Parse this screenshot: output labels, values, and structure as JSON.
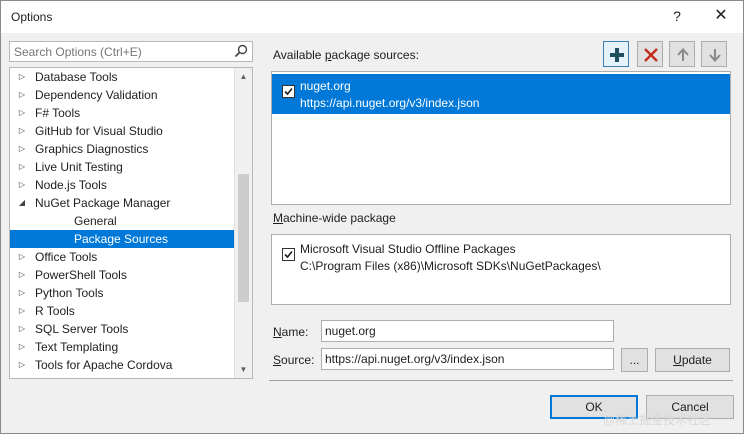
{
  "window": {
    "title": "Options",
    "help_glyph": "?",
    "close_glyph": "✕"
  },
  "search": {
    "placeholder": "Search Options (Ctrl+E)"
  },
  "tree": {
    "items": [
      {
        "label": "Database Tools",
        "level": 0,
        "expander": "▷"
      },
      {
        "label": "Dependency Validation",
        "level": 0,
        "expander": "▷"
      },
      {
        "label": "F# Tools",
        "level": 0,
        "expander": "▷"
      },
      {
        "label": "GitHub for Visual Studio",
        "level": 0,
        "expander": "▷"
      },
      {
        "label": "Graphics Diagnostics",
        "level": 0,
        "expander": "▷"
      },
      {
        "label": "Live Unit Testing",
        "level": 0,
        "expander": "▷"
      },
      {
        "label": "Node.js Tools",
        "level": 0,
        "expander": "▷"
      },
      {
        "label": "NuGet Package Manager",
        "level": 0,
        "expander": "◢"
      },
      {
        "label": "General",
        "level": 1,
        "expander": ""
      },
      {
        "label": "Package Sources",
        "level": 1,
        "expander": "",
        "selected": true
      },
      {
        "label": "Office Tools",
        "level": 0,
        "expander": "▷"
      },
      {
        "label": "PowerShell Tools",
        "level": 0,
        "expander": "▷"
      },
      {
        "label": "Python Tools",
        "level": 0,
        "expander": "▷"
      },
      {
        "label": "R Tools",
        "level": 0,
        "expander": "▷"
      },
      {
        "label": "SQL Server Tools",
        "level": 0,
        "expander": "▷"
      },
      {
        "label": "Text Templating",
        "level": 0,
        "expander": "▷"
      },
      {
        "label": "Tools for Apache Cordova",
        "level": 0,
        "expander": "▷"
      }
    ]
  },
  "available_sources": {
    "label_pre": "Available ",
    "label_accel": "p",
    "label_post": "ackage sources:",
    "items": [
      {
        "name": "nuget.org",
        "url": "https://api.nuget.org/v3/index.json",
        "checked": true,
        "selected": true
      }
    ]
  },
  "toolbar": {
    "add": "add-icon",
    "remove": "remove-icon",
    "move_up": "arrow-up-icon",
    "move_down": "arrow-down-icon"
  },
  "machine_wide": {
    "label_accel": "M",
    "label_post": "achine-wide package",
    "items": [
      {
        "name": "Microsoft Visual Studio Offline Packages",
        "url": "C:\\Program Files (x86)\\Microsoft SDKs\\NuGetPackages\\",
        "checked": true
      }
    ]
  },
  "form": {
    "name_accel": "N",
    "name_post": "ame:",
    "name_value": "nuget.org",
    "source_accel": "S",
    "source_post": "ource:",
    "source_value": "https://api.nuget.org/v3/index.json",
    "browse_label": "...",
    "update_accel": "U",
    "update_post": "pdate"
  },
  "footer": {
    "ok_label": "OK",
    "cancel_label": "Cancel"
  },
  "watermark": "@稀土掘金技术社区",
  "colors": {
    "accent": "#0078d7",
    "remove_red": "#c42b1c",
    "add_teal": "#1f4e5f"
  }
}
